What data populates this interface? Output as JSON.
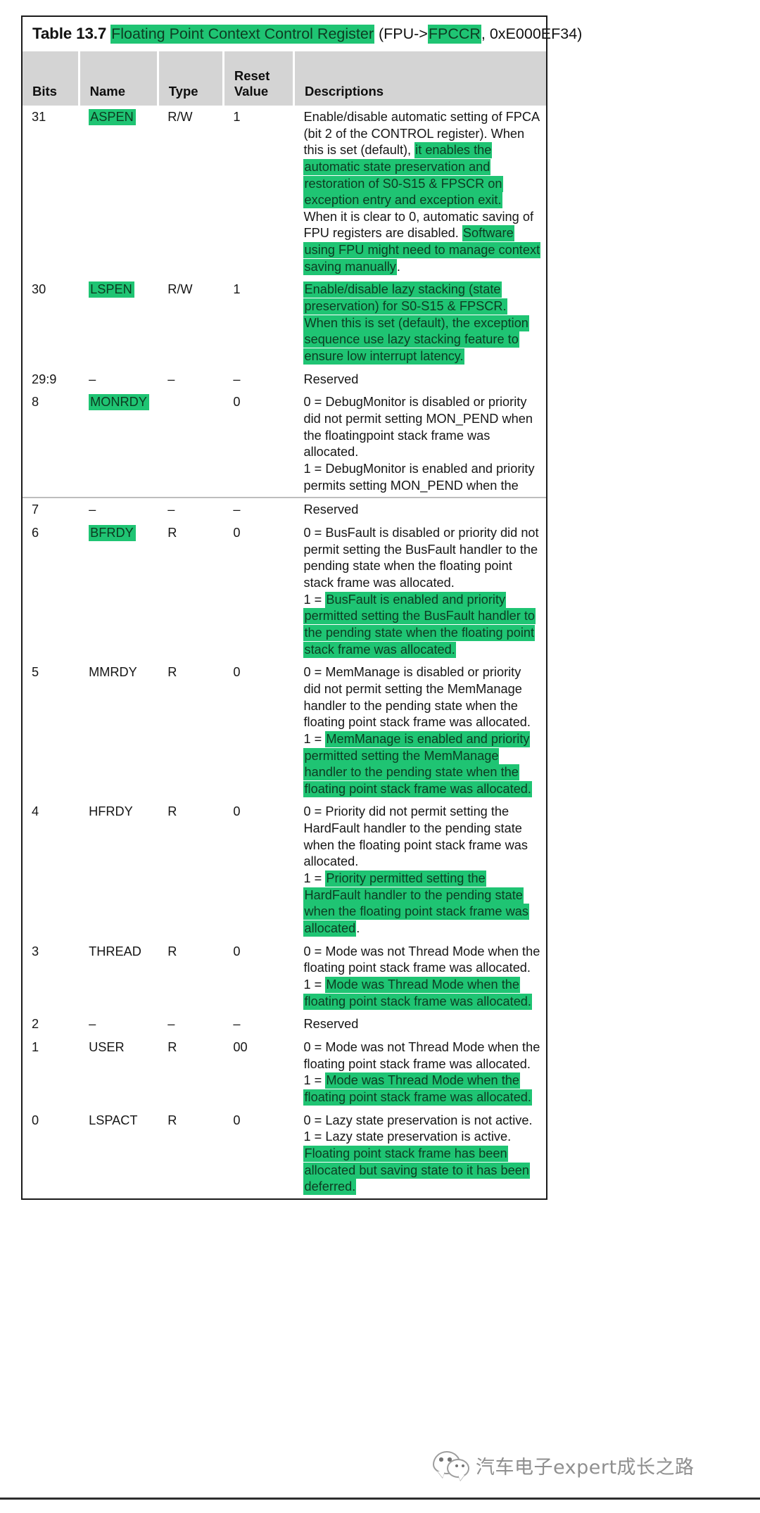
{
  "document": {
    "caption": {
      "table_number": "Table 13.7",
      "register_name": "Floating Point Context Control Register",
      "open_paren": "(FPU->",
      "register_short": "FPCCR",
      "address_suffix": ", 0xE000EF34)"
    },
    "columns": [
      "Bits",
      "Name",
      "Type",
      "Reset\nValue",
      "Descriptions"
    ],
    "column_headers": {
      "bits": "Bits",
      "name": "Name",
      "type": "Type",
      "reset_value_line1": "Reset",
      "reset_value_line2": "Value",
      "descriptions": "Descriptions"
    },
    "rows": [
      {
        "bits": "31",
        "name": "ASPEN",
        "name_highlighted": true,
        "type": "R/W",
        "reset": "1",
        "desc_segments": [
          {
            "text": "Enable/disable automatic setting of FPCA (bit 2 of the CONTROL register). When this is set (default), ",
            "hl": false
          },
          {
            "text": "it enables the automatic state preservation and restoration of S0-S15 & FPSCR on exception entry and exception exit.",
            "hl": true
          },
          {
            "text": "\nWhen it is clear to 0, automatic saving of FPU registers are disabled. ",
            "hl": false
          },
          {
            "text": "Software using FPU might need to manage context saving manually",
            "hl": true
          },
          {
            "text": ".",
            "hl": false
          }
        ]
      },
      {
        "bits": "30",
        "name": "LSPEN",
        "name_highlighted": true,
        "type": "R/W",
        "reset": "1",
        "desc_segments": [
          {
            "text": "Enable/disable lazy stacking (state preservation) for S0-S15 & FPSCR. When this is set (default), the exception sequence use lazy stacking feature to ensure low interrupt latency.",
            "hl": true
          }
        ]
      },
      {
        "bits": "29:9",
        "name": "–",
        "name_highlighted": false,
        "type": "–",
        "reset": "–",
        "desc_segments": [
          {
            "text": "Reserved",
            "hl": false
          }
        ]
      },
      {
        "bits": "8",
        "name": "MONRDY",
        "name_highlighted": true,
        "type": "",
        "reset": "0",
        "desc_segments": [
          {
            "text": "0 = DebugMonitor is disabled or priority did not permit setting MON_PEND when the floatingpoint stack frame was allocated.\n1 = DebugMonitor is enabled and priority permits setting MON_PEND when the",
            "hl": false
          }
        ]
      },
      {
        "bits": "7",
        "name": "–",
        "name_highlighted": false,
        "type": "–",
        "reset": "–",
        "desc_segments": [
          {
            "text": "Reserved",
            "hl": false
          }
        ],
        "page_break_before": true
      },
      {
        "bits": "6",
        "name": "BFRDY",
        "name_highlighted": true,
        "type": "R",
        "reset": "0",
        "desc_segments": [
          {
            "text": "0 = BusFault is disabled or priority did not permit setting the BusFault handler to the pending state when the floating point stack frame was allocated.\n1 = ",
            "hl": false
          },
          {
            "text": "BusFault is enabled and priority permitted setting the BusFault handler to the pending state when the floating point stack frame was allocated.",
            "hl": true
          }
        ]
      },
      {
        "bits": "5",
        "name": "MMRDY",
        "name_highlighted": false,
        "type": "R",
        "reset": "0",
        "desc_segments": [
          {
            "text": "0 = MemManage is disabled or priority did not permit setting the MemManage handler to the pending state when the floating point stack frame was allocated.\n1 = ",
            "hl": false
          },
          {
            "text": "MemManage is enabled and priority permitted setting the MemManage handler to the pending state when the floating point stack frame was allocated.",
            "hl": true
          }
        ]
      },
      {
        "bits": "4",
        "name": "HFRDY",
        "name_highlighted": false,
        "type": "R",
        "reset": "0",
        "desc_segments": [
          {
            "text": "0 = Priority did not permit setting the HardFault handler to the pending state when the floating point stack frame was allocated.\n1 = ",
            "hl": false
          },
          {
            "text": "Priority permitted setting the HardFault handler to the pending state when the floating point stack frame was allocated",
            "hl": true
          },
          {
            "text": ".",
            "hl": false
          }
        ]
      },
      {
        "bits": "3",
        "name": "THREAD",
        "name_highlighted": false,
        "type": "R",
        "reset": "0",
        "desc_segments": [
          {
            "text": "0 = Mode was not Thread Mode when the floating point stack frame was allocated.\n1 = ",
            "hl": false
          },
          {
            "text": "Mode was Thread Mode when the floating point stack frame was allocated.",
            "hl": true
          }
        ]
      },
      {
        "bits": "2",
        "name": "–",
        "name_highlighted": false,
        "type": "–",
        "reset": "–",
        "desc_segments": [
          {
            "text": "Reserved",
            "hl": false
          }
        ]
      },
      {
        "bits": "1",
        "name": "USER",
        "name_highlighted": false,
        "type": "R",
        "reset": "00",
        "desc_segments": [
          {
            "text": "0 = Mode was not Thread Mode when the floating point stack frame was allocated.\n1 = ",
            "hl": false
          },
          {
            "text": "Mode was Thread Mode when the floating point stack frame was allocated.",
            "hl": true
          }
        ]
      },
      {
        "bits": "0",
        "name": "LSPACT",
        "name_highlighted": false,
        "type": "R",
        "reset": "0",
        "desc_segments": [
          {
            "text": "0 = Lazy state preservation is not active.\n1 = Lazy state preservation is active. ",
            "hl": false
          },
          {
            "text": "Floating point stack frame has been allocated but saving state to it has been deferred.",
            "hl": true
          }
        ]
      }
    ]
  },
  "watermark": {
    "text": "汽车电子expert成长之路",
    "icon": "wechat-icon"
  },
  "colors": {
    "highlight_green": "#1fc473",
    "header_gray": "#d4d4d4",
    "border_dark": "#1b1b1b",
    "text": "#161616"
  }
}
